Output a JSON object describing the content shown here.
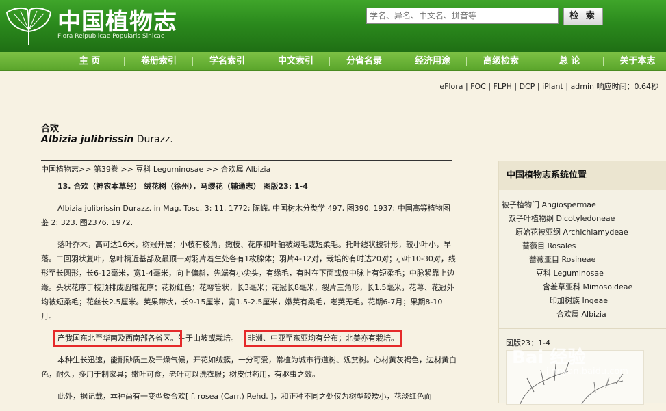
{
  "header": {
    "title": "中国植物志",
    "subtitle": "Flora Reipublicae Popularis Sinicae",
    "search_placeholder": "学名、异名、中文名、拼音等",
    "search_button": "检 索"
  },
  "nav": [
    "主 页",
    "卷册索引",
    "学名索引",
    "中文索引",
    "分省名录",
    "经济用途",
    "高级检索",
    "总 论",
    "关于本志"
  ],
  "toplinks": "eFlora | FOC | FLPH | DCP | iPlant | admin    响应时间：0.64秒",
  "taxon": {
    "cn_name": "合欢",
    "latin_name": "Albizia julibrissin",
    "author": "Durazz."
  },
  "breadcrumb": "中国植物志>> 第39卷 >> 豆科 Leguminosae >> 合欢属 Albizia",
  "content": {
    "title": "13. 合欢（神农本草经） 绒花树（徐州），马缨花（辅通志）  图版23: 1-4",
    "ref": "Albizia julibrissin Durazz. in Mag. Tosc. 3: 11. 1772; 陈嵘, 中国树木分类学 497, 图390. 1937; 中国高等植物图鉴 2: 323. 图2376. 1972.",
    "desc": "落叶乔木，高可达16米，树冠开展；小枝有棱角，嫩枝、花序和叶轴被绒毛或短柔毛。托叶线状披针形，较小叶小，早落。二回羽状复叶，总叶柄近基部及最顶一对羽片着生处各有1枚腺体；羽片4-12对，栽培的有时达20对；小叶10-30对，线形至长圆形，长6-12毫米，宽1-4毫米，向上偏斜，先端有小尖头，有缘毛，有时在下面或仅中脉上有短柔毛；中脉紧靠上边缘。头状花序于枝顶排成圆锥花序；花粉红色；花萼管状，长3毫米；花冠长8毫米，裂片三角形，长1.5毫米，花萼、花冠外均被短柔毛；花丝长2.5厘米。荚果带状，长9-15厘米，宽1.5-2.5厘米，嫩荚有柔毛，老荚无毛。花期6-7月；果期8-10月。",
    "dist_a": "产我国东北至华南及西南部各省区。",
    "dist_b": "生于山坡或栽培。",
    "dist_c": "非洲、中亚至东亚均有分布；北美亦有栽培。",
    "use": "本种生长迅速，能耐砂质土及干燥气候，开花如绒簇，十分可爱，常植为城市行道树、观赏树。心材黄灰褐色，边材黄白色，耐久，多用于制家具；嫩叶可食，老叶可以洗衣服；树皮供药用，有驱虫之效。",
    "more": "此外，据记载，本种尚有一变型矮合欢[ f. rosea (Carr.) Rehd. ]，和正种不同之处仅为树型较矮小，花淡红色而"
  },
  "sidebar": {
    "title": "中国植物志系统位置",
    "tree": [
      "被子植物门 Angiospermae",
      "双子叶植物纲 Dicotyledoneae",
      "原始花被亚纲 Archichlamydeae",
      "蔷薇目 Rosales",
      "蔷薇亚目 Rosineae",
      "豆科 Leguminosae",
      "含羞草亚科 Mimosoideae",
      "印加树族 Ingeae",
      "合欢属 Albizia"
    ],
    "figure_label": "图版23：1-4"
  },
  "watermark": {
    "main": "Bai 经验",
    "sub": "jingyan.baidu.com"
  }
}
